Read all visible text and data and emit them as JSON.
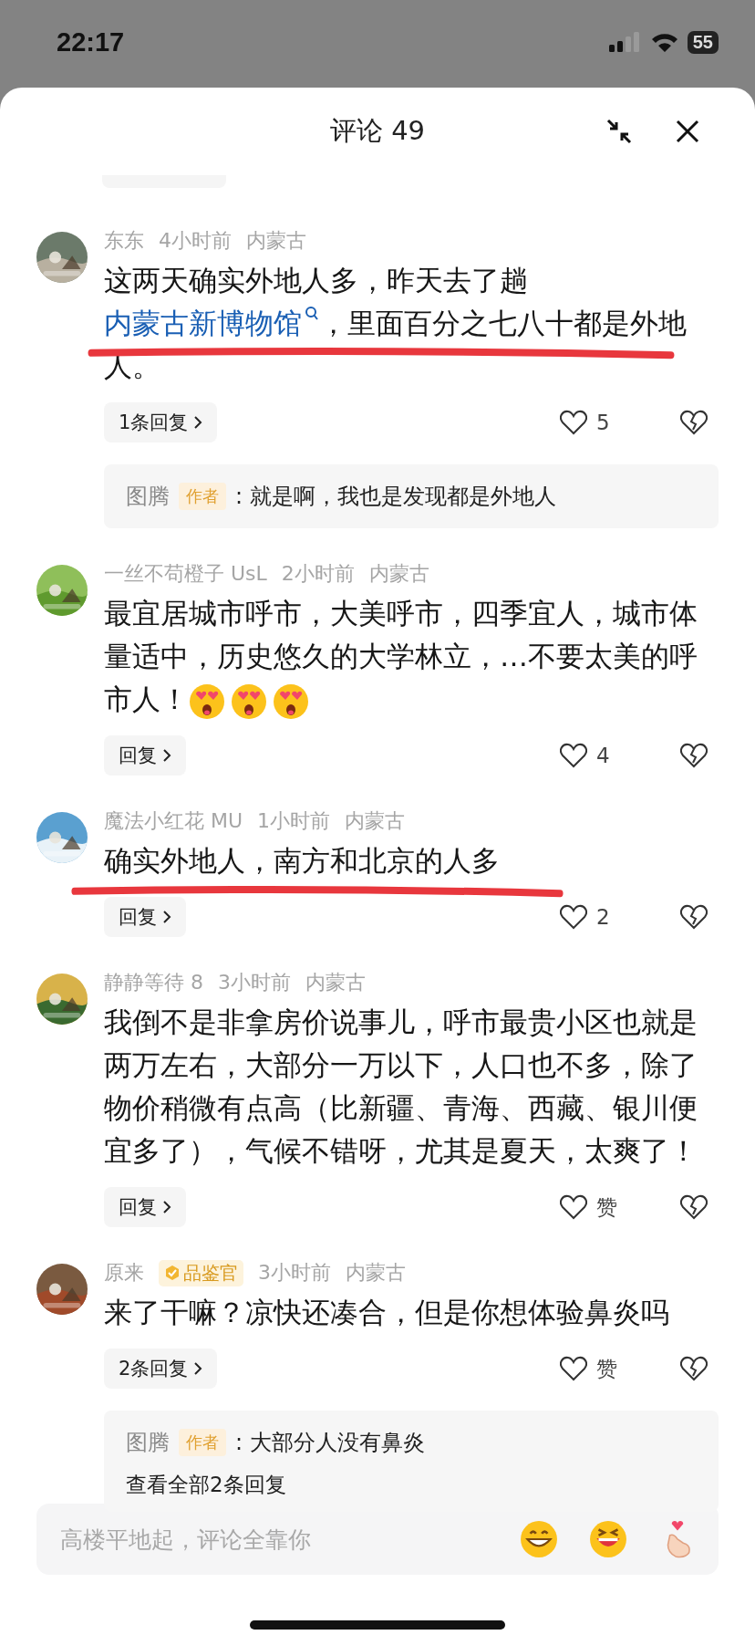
{
  "status_bar": {
    "time": "22:17",
    "battery": "55"
  },
  "header": {
    "title": "评论 49"
  },
  "comments": [
    {
      "user": "东东",
      "time": "4小时前",
      "location": "内蒙古",
      "body": [
        {
          "kind": "text",
          "text": "这两天确实外地人多，昨天去了趟"
        },
        {
          "kind": "link",
          "text": "内蒙古新博物馆"
        },
        {
          "kind": "text",
          "text": "，里面百分之七八十都是外地人。"
        }
      ],
      "underlined": true,
      "reply_button": "1条回复",
      "likes": "5",
      "author_reply": {
        "name": "图腾",
        "tag": "作者",
        "text": ": 就是啊，我也是发现都是外地人"
      }
    },
    {
      "user": "一丝不苟橙子 UsL",
      "time": "2小时前",
      "location": "内蒙古",
      "body": [
        {
          "kind": "text",
          "text": "最宜居城市呼市，大美呼市，四季宜人，城市体量适中，历史悠久的大学林立，…不要太美的呼市人！"
        },
        {
          "kind": "emoji"
        },
        {
          "kind": "emoji"
        },
        {
          "kind": "emoji"
        }
      ],
      "underlined": false,
      "reply_button": "回复",
      "likes": "4"
    },
    {
      "user": "魔法小红花 MU",
      "time": "1小时前",
      "location": "内蒙古",
      "body": [
        {
          "kind": "text",
          "text": "确实外地人，南方和北京的人多"
        }
      ],
      "underlined": true,
      "reply_button": "回复",
      "likes": "2"
    },
    {
      "user": "静静等待 8",
      "time": "3小时前",
      "location": "内蒙古",
      "body": [
        {
          "kind": "text",
          "text": "我倒不是非拿房价说事儿，呼市最贵小区也就是两万左右，大部分一万以下，人口也不多，除了物价稍微有点高（比新疆、青海、西藏、银川便宜多了），气候不错呀，尤其是夏天，太爽了！"
        }
      ],
      "underlined": false,
      "reply_button": "回复",
      "likes": "赞"
    },
    {
      "user": "原来",
      "badge": "品鉴官",
      "time": "3小时前",
      "location": "内蒙古",
      "body": [
        {
          "kind": "text",
          "text": "来了干嘛？凉快还凑合，但是你想体验鼻炎吗"
        }
      ],
      "underlined": false,
      "reply_button": "2条回复",
      "likes": "赞",
      "author_reply": {
        "name": "图腾",
        "tag": "作者",
        "text": ": 大部分人没有鼻炎"
      },
      "view_all": "查看全部2条回复"
    }
  ],
  "input": {
    "placeholder": "高楼平地起，评论全靠你"
  }
}
